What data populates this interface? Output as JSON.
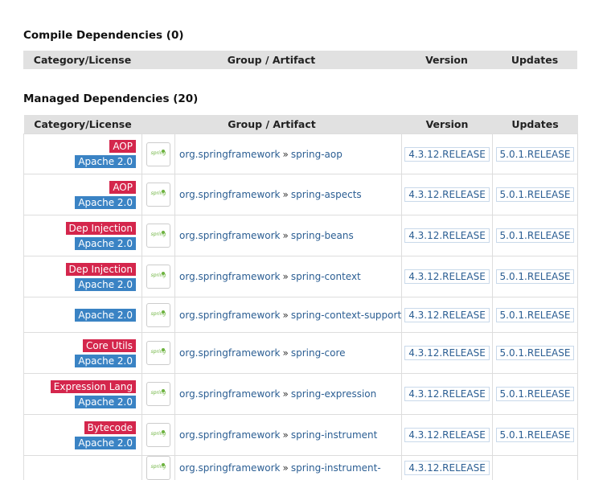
{
  "compile": {
    "title": "Compile Dependencies (0)",
    "headers": [
      "Category/License",
      "Group / Artifact",
      "Version",
      "Updates"
    ]
  },
  "managed": {
    "title": "Managed Dependencies (20)",
    "headers": [
      "Category/License",
      "Group / Artifact",
      "Version",
      "Updates"
    ],
    "separator": "»",
    "rows": [
      {
        "category": "AOP",
        "license": "Apache 2.0",
        "group": "org.springframework",
        "artifact": "spring-aop",
        "version": "4.3.12.RELEASE",
        "update": "5.0.1.RELEASE"
      },
      {
        "category": "AOP",
        "license": "Apache 2.0",
        "group": "org.springframework",
        "artifact": "spring-aspects",
        "version": "4.3.12.RELEASE",
        "update": "5.0.1.RELEASE"
      },
      {
        "category": "Dep Injection",
        "license": "Apache 2.0",
        "group": "org.springframework",
        "artifact": "spring-beans",
        "version": "4.3.12.RELEASE",
        "update": "5.0.1.RELEASE"
      },
      {
        "category": "Dep Injection",
        "license": "Apache 2.0",
        "group": "org.springframework",
        "artifact": "spring-context",
        "version": "4.3.12.RELEASE",
        "update": "5.0.1.RELEASE"
      },
      {
        "category": "",
        "license": "Apache 2.0",
        "group": "org.springframework",
        "artifact": "spring-context-support",
        "version": "4.3.12.RELEASE",
        "update": "5.0.1.RELEASE"
      },
      {
        "category": "Core Utils",
        "license": "Apache 2.0",
        "group": "org.springframework",
        "artifact": "spring-core",
        "version": "4.3.12.RELEASE",
        "update": "5.0.1.RELEASE"
      },
      {
        "category": "Expression Lang",
        "license": "Apache 2.0",
        "group": "org.springframework",
        "artifact": "spring-expression",
        "version": "4.3.12.RELEASE",
        "update": "5.0.1.RELEASE"
      },
      {
        "category": "Bytecode",
        "license": "Apache 2.0",
        "group": "org.springframework",
        "artifact": "spring-instrument",
        "version": "4.3.12.RELEASE",
        "update": "5.0.1.RELEASE"
      },
      {
        "category": "",
        "license": "",
        "group": "org.springframework",
        "artifact": "spring-instrument-",
        "version": "4.3.12.RELEASE",
        "update": ""
      }
    ]
  },
  "logo_text": "spring",
  "colors": {
    "category_badge": "#d4264c",
    "license_badge": "#3a83c4",
    "header_bg": "#e1e1e1",
    "link": "#2b5e93"
  }
}
